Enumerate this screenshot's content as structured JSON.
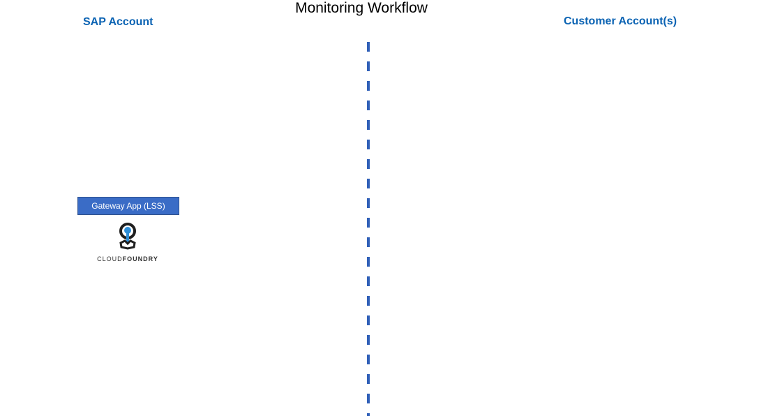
{
  "diagram": {
    "title": "Monitoring Workflow",
    "left_column": {
      "label": "SAP Account"
    },
    "right_column": {
      "label": "Customer Account(s)"
    },
    "gateway": {
      "label": "Gateway App (LSS)"
    },
    "logo": {
      "icon": "cloud-foundry-icon",
      "text_light": "CLOUD",
      "text_bold": "FOUNDRY"
    }
  },
  "colors": {
    "heading": "#0b63b3",
    "divider": "#3060b8",
    "box_fill": "#3a6cc6",
    "box_border": "#2f528f",
    "logo_dark": "#1f1f1f",
    "logo_blue": "#2f8fd8"
  }
}
